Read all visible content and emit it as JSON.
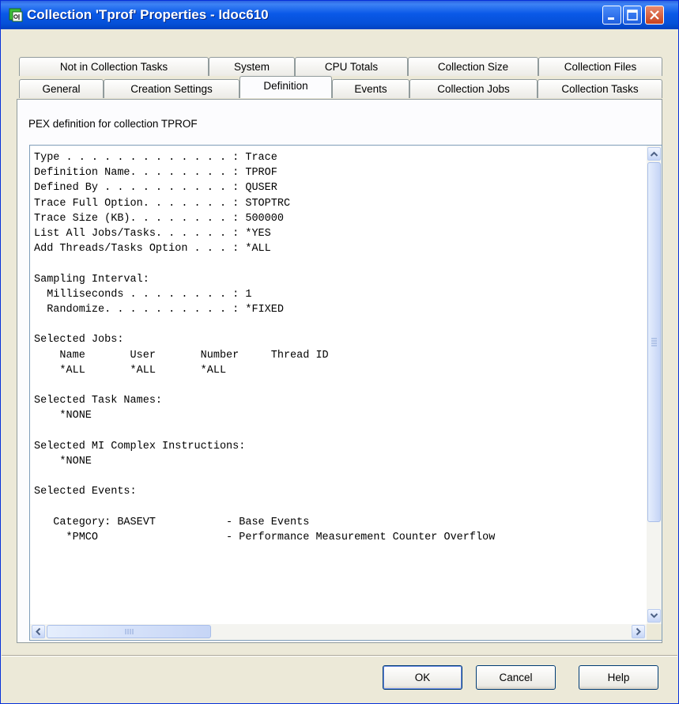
{
  "window": {
    "title": "Collection 'Tprof' Properties - Idoc610"
  },
  "tabs": {
    "row1": [
      "Not in Collection Tasks",
      "System",
      "CPU Totals",
      "Collection Size",
      "Collection Files"
    ],
    "row2": [
      "General",
      "Creation Settings",
      "Definition",
      "Events",
      "Collection Jobs",
      "Collection Tasks"
    ],
    "selected": "Definition"
  },
  "definition": {
    "description": "PEX definition for collection TPROF",
    "content": "Type . . . . . . . . . . . . . : Trace\nDefinition Name. . . . . . . . : TPROF\nDefined By . . . . . . . . . . : QUSER\nTrace Full Option. . . . . . . : STOPTRC\nTrace Size (KB). . . . . . . . : 500000\nList All Jobs/Tasks. . . . . . : *YES\nAdd Threads/Tasks Option . . . : *ALL\n\nSampling Interval:\n  Milliseconds . . . . . . . . : 1\n  Randomize. . . . . . . . . . : *FIXED\n\nSelected Jobs:\n    Name       User       Number     Thread ID\n    *ALL       *ALL       *ALL\n\nSelected Task Names:\n    *NONE\n\nSelected MI Complex Instructions:\n    *NONE\n\nSelected Events:\n\n   Category: BASEVT           - Base Events\n     *PMCO                    - Performance Measurement Counter Overflow"
  },
  "buttons": {
    "ok": "OK",
    "cancel": "Cancel",
    "help": "Help"
  }
}
